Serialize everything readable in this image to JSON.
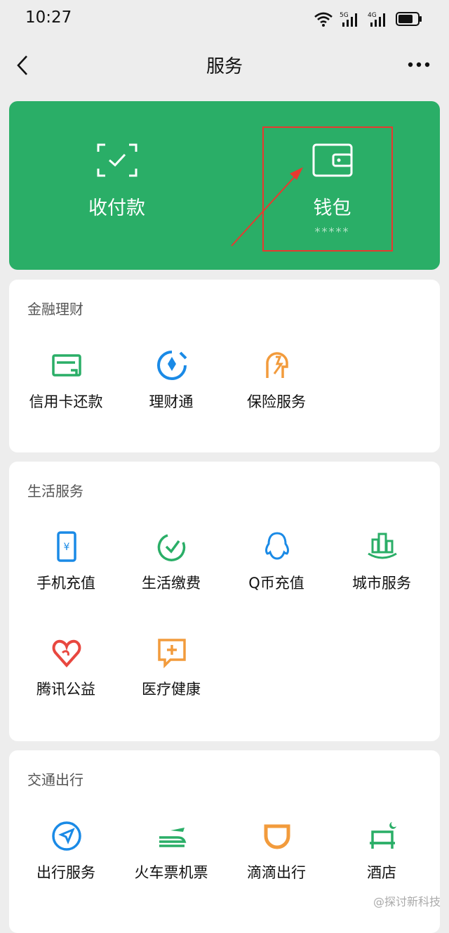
{
  "status": {
    "time": "10:27",
    "network1": "5G",
    "network2": "4G"
  },
  "nav": {
    "title": "服务"
  },
  "hero": {
    "pay_label": "收付款",
    "wallet_label": "钱包",
    "wallet_balance": "*****"
  },
  "finance": {
    "title": "金融理财",
    "items": [
      {
        "label": "信用卡还款",
        "icon": "credit-card-icon"
      },
      {
        "label": "理财通",
        "icon": "wealth-icon"
      },
      {
        "label": "保险服务",
        "icon": "insurance-icon"
      }
    ]
  },
  "life": {
    "title": "生活服务",
    "items": [
      {
        "label": "手机充值",
        "icon": "phone-topup-icon"
      },
      {
        "label": "生活缴费",
        "icon": "utility-bill-icon"
      },
      {
        "label": "Q币充值",
        "icon": "qq-coin-icon"
      },
      {
        "label": "城市服务",
        "icon": "city-service-icon"
      },
      {
        "label": "腾讯公益",
        "icon": "charity-heart-icon"
      },
      {
        "label": "医疗健康",
        "icon": "medical-icon"
      }
    ]
  },
  "travel": {
    "title": "交通出行",
    "items": [
      {
        "label": "出行服务",
        "icon": "navigation-icon"
      },
      {
        "label": "火车票机票",
        "icon": "train-plane-icon"
      },
      {
        "label": "滴滴出行",
        "icon": "didi-icon"
      },
      {
        "label": "酒店",
        "icon": "hotel-bed-icon"
      }
    ]
  },
  "watermark": "@探讨新科技",
  "colors": {
    "brand_green": "#2aae67",
    "highlight_red": "#e8392f"
  }
}
